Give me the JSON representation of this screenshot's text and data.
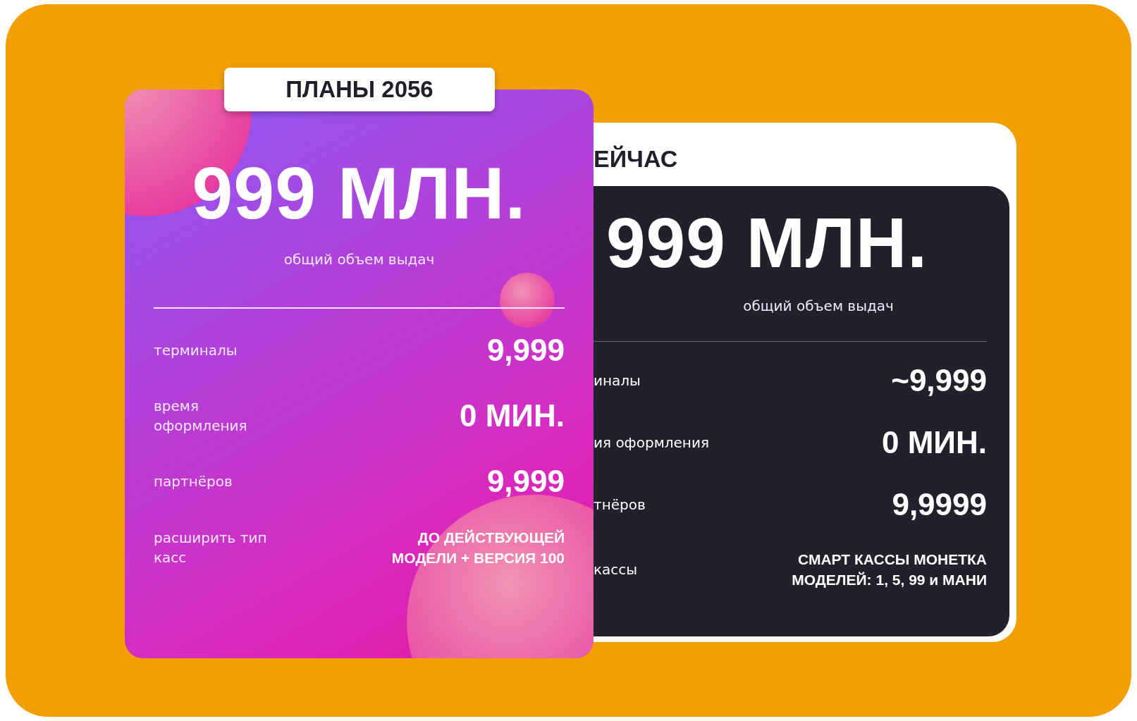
{
  "plan_card": {
    "tab_label": "ПЛАНЫ 2056",
    "headline": "999 МЛН.",
    "caption": "общий объем выдач",
    "rows": [
      {
        "label": "терминалы",
        "value": "9,999"
      },
      {
        "label": "время оформления",
        "value": "0 МИН."
      },
      {
        "label": "партнёров",
        "value": "9,999"
      },
      {
        "label": "расширить тип касс",
        "value": "ДО ДЕЙСТВУЮЩЕЙ МОДЕЛИ + ВЕРСИЯ 100",
        "kind": "small"
      }
    ]
  },
  "current_card": {
    "title": "ЕЙЧАС",
    "headline": "999 МЛН.",
    "caption": "общий объем выдач",
    "rows": [
      {
        "label": "иналы",
        "value": "~9,999"
      },
      {
        "label": "ия оформления",
        "value": "0 МИН."
      },
      {
        "label": "тнёров",
        "value": "9,9999"
      },
      {
        "label": "кассы",
        "value": "СМАРТ КАССЫ МОНЕТКА МОДЕЛЕЙ: 1, 5, 99 и МАНИ",
        "kind": "small"
      }
    ]
  }
}
